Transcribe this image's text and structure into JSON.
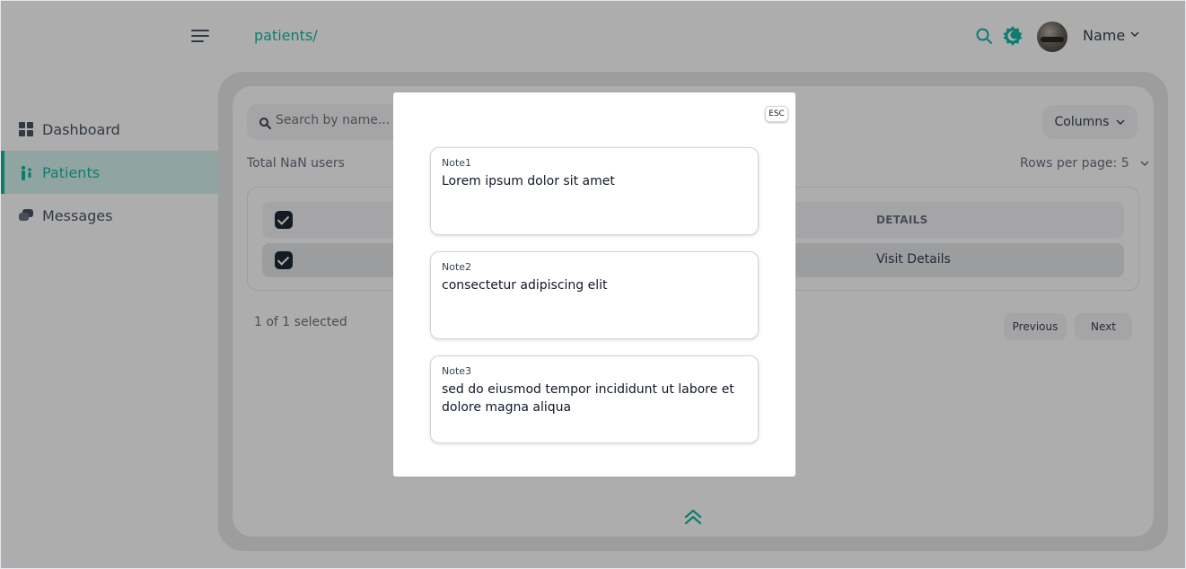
{
  "header": {
    "breadcrumb": "patients/",
    "user_name": "Name",
    "icons": [
      "menu-icon",
      "search-icon",
      "theme-toggle-icon",
      "chevron-down-icon"
    ]
  },
  "sidebar": {
    "items": [
      {
        "label": "Dashboard",
        "icon": "grid-icon",
        "active": false
      },
      {
        "label": "Patients",
        "icon": "patients-icon",
        "active": true
      },
      {
        "label": "Messages",
        "icon": "messages-icon",
        "active": false
      }
    ]
  },
  "main": {
    "search_placeholder": "Search by name...",
    "columns_label": "Columns",
    "total_users": "Total NaN users",
    "rows_per_page": "Rows per page: 5",
    "table": {
      "header_details": "DETAILS",
      "rows": [
        {
          "details": "Visit Details",
          "checked": true
        }
      ]
    },
    "selected_count": "1 of 1 selected",
    "previous_label": "Previous",
    "next_label": "Next"
  },
  "modal": {
    "esc_label": "ESC",
    "notes": [
      {
        "label": "Note1",
        "text": "Lorem ipsum dolor sit amet"
      },
      {
        "label": "Note2",
        "text": "consectetur adipiscing elit"
      },
      {
        "label": "Note3",
        "text": "sed do eiusmod tempor incididunt ut labore et dolore magna aliqua"
      }
    ]
  },
  "colors": {
    "accent": "#14b8a6",
    "active_bg": "#d5f3ef",
    "overlay": "rgba(0,0,0,0.32)"
  }
}
